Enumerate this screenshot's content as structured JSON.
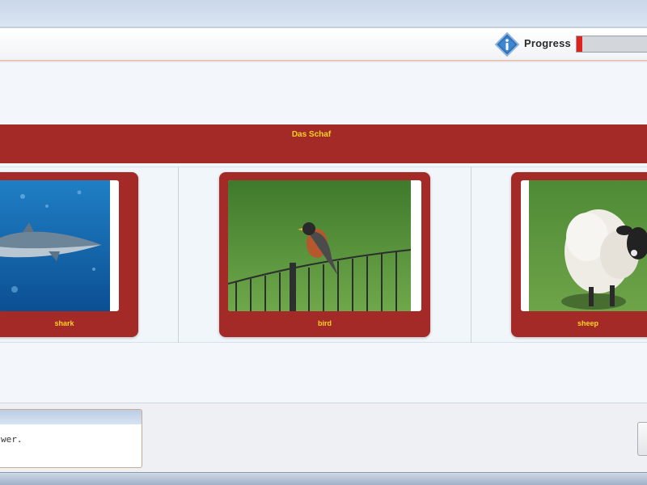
{
  "toolbar": {
    "info_icon": "info-diamond-icon",
    "progress_label": "Progress",
    "progress": 0.08,
    "progress_color": "#e0221c"
  },
  "question": {
    "prompt": "Das Schaf"
  },
  "cards": [
    {
      "label": "shark",
      "icon": "shark-photo"
    },
    {
      "label": "bird",
      "icon": "bird-photo"
    },
    {
      "label": "sheep",
      "icon": "sheep-photo"
    }
  ],
  "footer": {
    "message": "wer."
  },
  "colors": {
    "band": "#a32a27",
    "label": "#ffd21f"
  }
}
